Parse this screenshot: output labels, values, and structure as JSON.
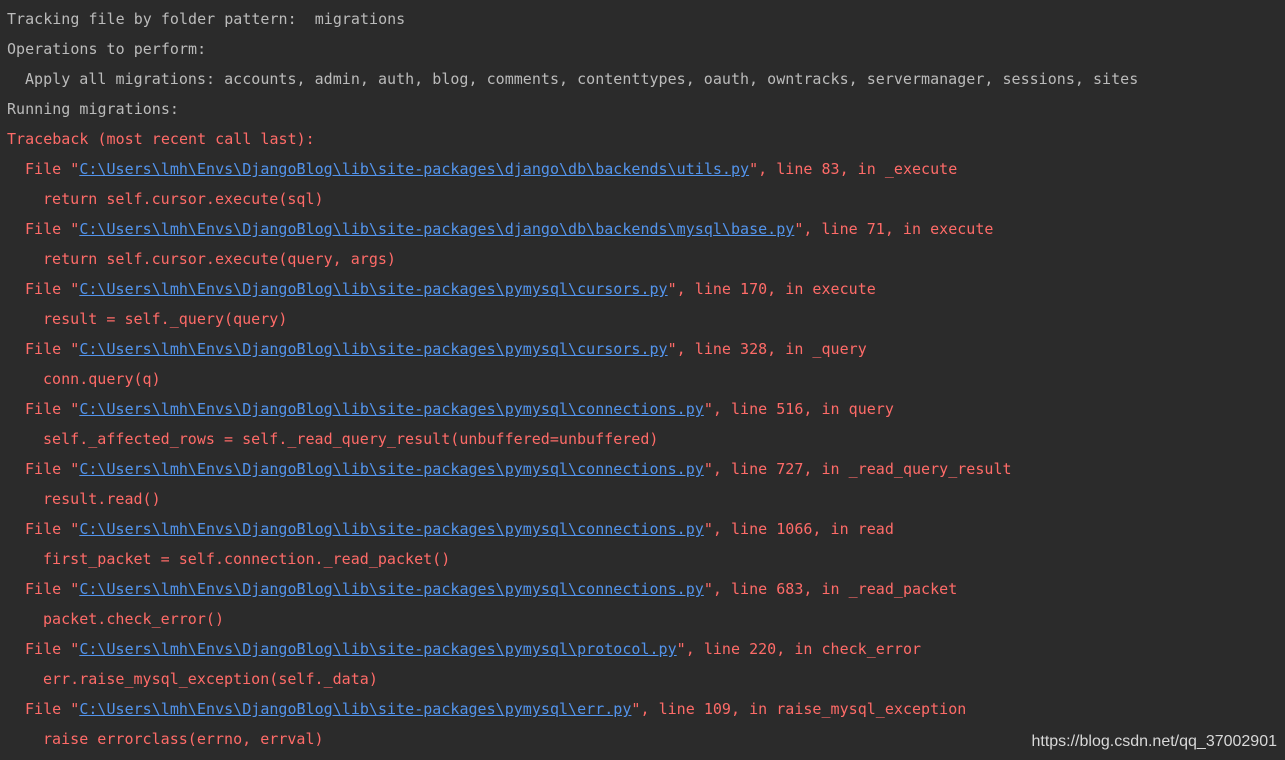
{
  "colors": {
    "background": "#2b2b2b",
    "plain_text": "#bbbbbb",
    "error_text": "#ff6b68",
    "link_text": "#5394ec"
  },
  "output": {
    "tracking": "Tracking file by folder pattern:  migrations",
    "operations_header": "Operations to perform:",
    "apply_all": "Apply all migrations: accounts, admin, auth, blog, comments, contenttypes, oauth, owntracks, servermanager, sessions, sites",
    "running": "Running migrations:",
    "traceback_header": "Traceback (most recent call last):",
    "frames": [
      {
        "prefix": "File \"",
        "path": "C:\\Users\\lmh\\Envs\\DjangoBlog\\lib\\site-packages\\django\\db\\backends\\utils.py",
        "suffix": "\", line 83, in _execute",
        "code": "return self.cursor.execute(sql)"
      },
      {
        "prefix": "File \"",
        "path": "C:\\Users\\lmh\\Envs\\DjangoBlog\\lib\\site-packages\\django\\db\\backends\\mysql\\base.py",
        "suffix": "\", line 71, in execute",
        "code": "return self.cursor.execute(query, args)"
      },
      {
        "prefix": "File \"",
        "path": "C:\\Users\\lmh\\Envs\\DjangoBlog\\lib\\site-packages\\pymysql\\cursors.py",
        "suffix": "\", line 170, in execute",
        "code": "result = self._query(query)"
      },
      {
        "prefix": "File \"",
        "path": "C:\\Users\\lmh\\Envs\\DjangoBlog\\lib\\site-packages\\pymysql\\cursors.py",
        "suffix": "\", line 328, in _query",
        "code": "conn.query(q)"
      },
      {
        "prefix": "File \"",
        "path": "C:\\Users\\lmh\\Envs\\DjangoBlog\\lib\\site-packages\\pymysql\\connections.py",
        "suffix": "\", line 516, in query",
        "code": "self._affected_rows = self._read_query_result(unbuffered=unbuffered)"
      },
      {
        "prefix": "File \"",
        "path": "C:\\Users\\lmh\\Envs\\DjangoBlog\\lib\\site-packages\\pymysql\\connections.py",
        "suffix": "\", line 727, in _read_query_result",
        "code": "result.read()"
      },
      {
        "prefix": "File \"",
        "path": "C:\\Users\\lmh\\Envs\\DjangoBlog\\lib\\site-packages\\pymysql\\connections.py",
        "suffix": "\", line 1066, in read",
        "code": "first_packet = self.connection._read_packet()"
      },
      {
        "prefix": "File \"",
        "path": "C:\\Users\\lmh\\Envs\\DjangoBlog\\lib\\site-packages\\pymysql\\connections.py",
        "suffix": "\", line 683, in _read_packet",
        "code": "packet.check_error()"
      },
      {
        "prefix": "File \"",
        "path": "C:\\Users\\lmh\\Envs\\DjangoBlog\\lib\\site-packages\\pymysql\\protocol.py",
        "suffix": "\", line 220, in check_error",
        "code": "err.raise_mysql_exception(self._data)"
      },
      {
        "prefix": "File \"",
        "path": "C:\\Users\\lmh\\Envs\\DjangoBlog\\lib\\site-packages\\pymysql\\err.py",
        "suffix": "\", line 109, in raise_mysql_exception",
        "code": "raise errorclass(errno, errval)"
      }
    ]
  },
  "watermark": "https://blog.csdn.net/qq_37002901"
}
